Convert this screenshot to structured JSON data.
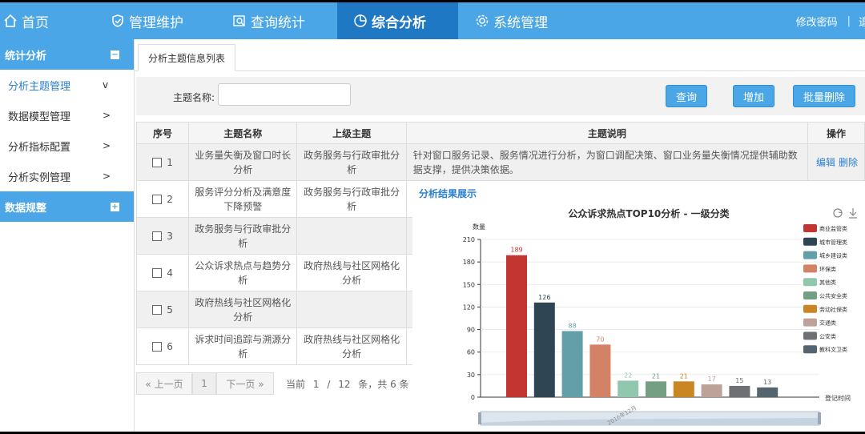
{
  "nav": {
    "items": [
      {
        "label": "首页",
        "icon": "home-icon"
      },
      {
        "label": "管理维护",
        "icon": "check-shield-icon"
      },
      {
        "label": "查询统计",
        "icon": "search-report-icon"
      },
      {
        "label": "综合分析",
        "icon": "pie-chart-icon",
        "active": true
      },
      {
        "label": "系统管理",
        "icon": "gear-icon"
      }
    ],
    "change_password": "修改密码",
    "separator": "|",
    "cut_label": "退"
  },
  "sidebar": {
    "group1": {
      "label": "统计分析",
      "toggle": "−"
    },
    "items": [
      {
        "label": "分析主题管理",
        "chev": "v",
        "active": true
      },
      {
        "label": "数据模型管理",
        "chev": ">"
      },
      {
        "label": "分析指标配置",
        "chev": ">"
      },
      {
        "label": "分析实例管理",
        "chev": ">"
      }
    ],
    "group2": {
      "label": "数据规整",
      "toggle": "+"
    }
  },
  "tab": {
    "label": "分析主题信息列表"
  },
  "search": {
    "label": "主题名称:",
    "value": "",
    "query_button": "查询",
    "add_button": "增加",
    "batch_delete_button": "批量删除"
  },
  "table": {
    "headers": [
      "序号",
      "主题名称",
      "上级主题",
      "主题说明",
      "操作"
    ],
    "rows": [
      {
        "no": "1",
        "name": "业务量失衡及窗口时长分析",
        "parent": "政务服务与行政审批分析",
        "desc": "针对窗口服务记录、服务情况进行分析，为窗口调配决策、窗口业务量失衡情况提供辅助数据支撑，提供决策依据。",
        "edit": "编辑",
        "delete": "删除"
      },
      {
        "no": "2",
        "name": "服务评分分析及满意度下降预警",
        "parent": "政务服务与行政审批分析",
        "desc": "",
        "edit": "",
        "delete": ""
      },
      {
        "no": "3",
        "name": "政务服务与行政审批分析",
        "parent": "",
        "desc": "",
        "edit": "",
        "delete": ""
      },
      {
        "no": "4",
        "name": "公众诉求热点与趋势分析",
        "parent": "政府热线与社区网格化分析",
        "desc": "",
        "edit": "",
        "delete": ""
      },
      {
        "no": "5",
        "name": "政府热线与社区网格化分析",
        "parent": "",
        "desc": "",
        "edit": "",
        "delete": ""
      },
      {
        "no": "6",
        "name": "诉求时间追踪与溯源分析",
        "parent": "政府热线与社区网格化分析",
        "desc": "",
        "edit": "",
        "delete": ""
      }
    ]
  },
  "pager": {
    "prev": "« 上一页",
    "page": "1",
    "next": "下一页 »",
    "current_label": "当前",
    "current_page": "1",
    "slash": "/",
    "total_pages": "12",
    "tail": "条，共 6 条"
  },
  "chart_panel": {
    "heading": "分析结果展示"
  },
  "chart_data": {
    "type": "bar",
    "title": "公众诉求热点TOP10分析 - 一级分类",
    "ylabel": "数量",
    "xlabel": "登记时间",
    "x_tick": "2016年12月",
    "ylim": [
      0,
      210
    ],
    "yticks": [
      0,
      30,
      60,
      90,
      120,
      150,
      180,
      210
    ],
    "legend_position": "right",
    "series": [
      {
        "name": "商业监管类",
        "value": 189,
        "color": "#c23531"
      },
      {
        "name": "城市管理类",
        "value": 126,
        "color": "#2f4554"
      },
      {
        "name": "城乡建设类",
        "value": 88,
        "color": "#61a0a8"
      },
      {
        "name": "环保类",
        "value": 70,
        "color": "#d48265"
      },
      {
        "name": "其他类",
        "value": 22,
        "color": "#91c7ae"
      },
      {
        "name": "公共安全类",
        "value": 21,
        "color": "#749f83"
      },
      {
        "name": "劳动社保类",
        "value": 21,
        "color": "#ca8622"
      },
      {
        "name": "交通类",
        "value": 17,
        "color": "#bda29a"
      },
      {
        "name": "公安类",
        "value": 15,
        "color": "#6e7074"
      },
      {
        "name": "教科文卫类",
        "value": 13,
        "color": "#546570"
      }
    ]
  }
}
